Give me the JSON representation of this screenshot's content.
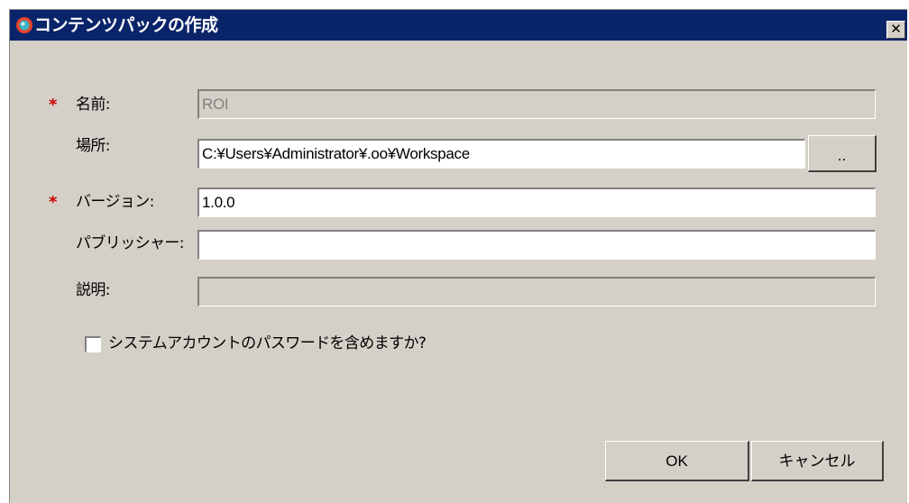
{
  "window": {
    "title": "コンテンツパックの作成",
    "close_glyph": "✕"
  },
  "form": {
    "required_marker": "*",
    "name": {
      "label": "名前:",
      "value": "ROI",
      "required": true,
      "enabled": false
    },
    "location": {
      "label": "場所:",
      "value": "C:¥Users¥Administrator¥.oo¥Workspace",
      "browse_label": ".."
    },
    "version": {
      "label": "バージョン:",
      "value": "1.0.0",
      "required": true
    },
    "publisher": {
      "label": "パブリッシャー:",
      "value": ""
    },
    "description": {
      "label": "説明:",
      "value": "",
      "enabled": false
    },
    "include_passwords": {
      "label": "システムアカウントのパスワードを含めますか?",
      "checked": false
    }
  },
  "buttons": {
    "ok_label": "OK",
    "cancel_label": "キャンセル"
  },
  "colors": {
    "titlebar": "#0a246a",
    "dialog_bg": "#d4d0c8",
    "required_marker": "#cc0000",
    "app_icon_ring": "#e8452c"
  },
  "icons": {
    "app": "content-pack-app-icon",
    "close": "close-icon",
    "checkbox": "checkbox-icon"
  }
}
